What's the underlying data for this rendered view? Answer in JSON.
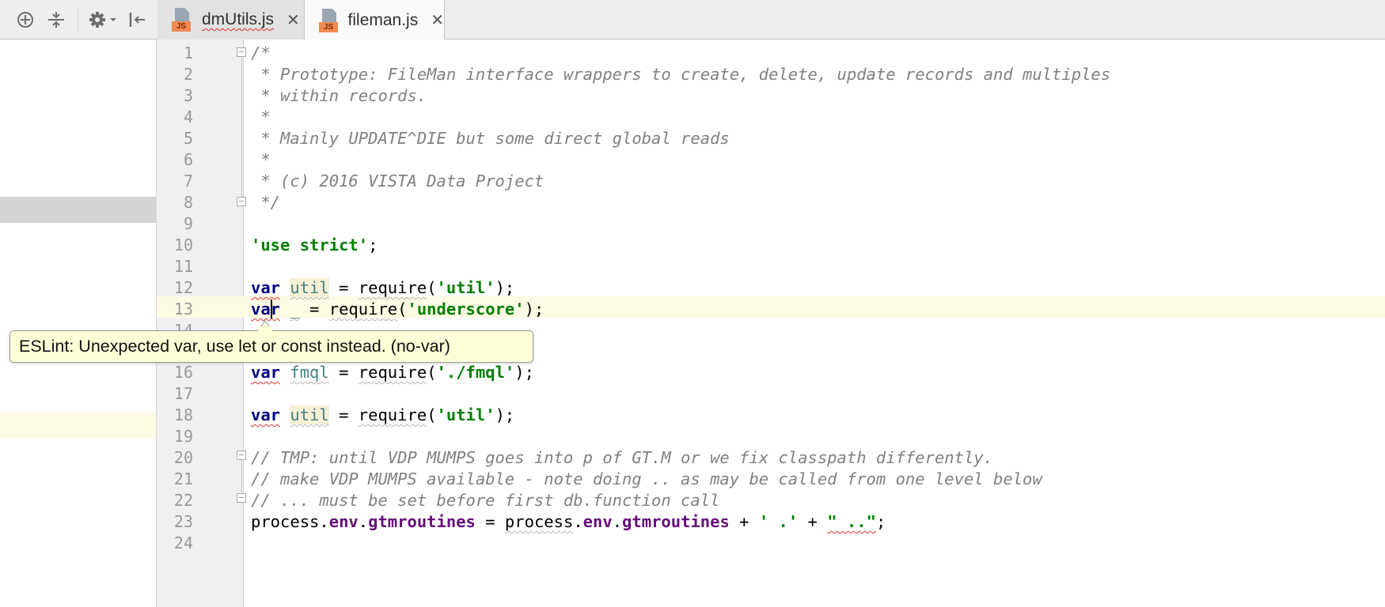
{
  "tabs": [
    {
      "label": "dmUtils.js",
      "badge": "JS",
      "active": false,
      "close": "✕"
    },
    {
      "label": "fileman.js",
      "badge": "JS",
      "active": true,
      "close": "✕"
    }
  ],
  "toolbar_icons": [
    "crosshair-icon",
    "collapse-icon",
    "gear-icon",
    "hide-panel-icon"
  ],
  "tooltip": "ESLint: Unexpected var, use let or const instead. (no-var)",
  "line_numbers": [
    "1",
    "2",
    "3",
    "4",
    "5",
    "6",
    "7",
    "8",
    "9",
    "10",
    "11",
    "12",
    "13",
    "14",
    "16",
    "17",
    "18",
    "19",
    "20",
    "21",
    "22",
    "23",
    "24"
  ],
  "code": {
    "l1": "/*",
    "l2": " * Prototype: FileMan interface wrappers to create, delete, update records and multiples",
    "l3": " * within records.",
    "l4": " *",
    "l5": " * Mainly UPDATE^DIE but some direct global reads",
    "l6": " *",
    "l7": " * (c) 2016 VISTA Data Project",
    "l8": " */",
    "l10": "'use strict'",
    "semi": ";",
    "kw_var": "var",
    "id_util": "util",
    "id_underscore": "_",
    "id_fmql": "fmql",
    "eq": " = ",
    "require": "require",
    "open": "(",
    "close": ");",
    "s_util": "'util'",
    "s_underscore": "'underscore'",
    "s_fmql": "'./fmql'",
    "l20": "// TMP: until VDP MUMPS goes into p of GT.M or we fix classpath differently.",
    "l21": "// make VDP MUMPS available - note doing .. as may be called from one level below",
    "l22": "// ... must be set before first db.function call",
    "process": "process",
    "dot": ".",
    "env": "env",
    "gtmroutines": "gtmroutines",
    "plus": " + ",
    "s_dot": "' .'",
    "s_dotdot": "\" ..\""
  }
}
